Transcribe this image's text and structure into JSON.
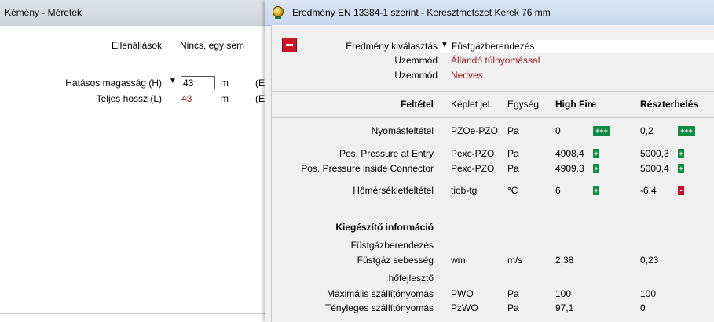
{
  "back_window": {
    "title": "Kémény - Méretek",
    "resistances_label": "Ellenállások",
    "resistances_value": "Nincs, egy sem",
    "height_label": "Hatásos magasság (H)",
    "height_value": "43",
    "height_unit": "m",
    "height_trailing": "(E",
    "length_label": "Teljes hossz (L)",
    "length_value": "43",
    "length_unit": "m",
    "length_trailing": "(E"
  },
  "front_window": {
    "title": "Eredmény EN 13384-1 szerint - Keresztmetszet Kerek 76 mm",
    "result_selection_label": "Eredmény kiválasztás",
    "result_selection_value": "Füstgázberendezés",
    "mode1_label": "Üzemmód",
    "mode1_value": "Állandó túlnyomással",
    "mode2_label": "Üzemmód",
    "mode2_value": "Nedves",
    "headers": {
      "condition": "Feltétel",
      "symbol": "Képlet jel.",
      "unit": "Egység",
      "high": "High Fire",
      "partial": "Részterhelés"
    },
    "rows": [
      {
        "label": "Nyomásfeltétel",
        "symbol": "PZOe-PZO",
        "unit": "Pa",
        "high": "0",
        "high_badge": "+++",
        "partial": "0,2",
        "partial_badge": "+++"
      },
      {
        "label": "Pos. Pressure at Entry",
        "symbol": "Pexc-PZO",
        "unit": "Pa",
        "high": "4908,4",
        "high_badge": "+",
        "partial": "5000,3",
        "partial_badge": "+"
      },
      {
        "label": "Pos. Pressure inside Connector",
        "symbol": "Pexc-PZO",
        "unit": "Pa",
        "high": "4909,3",
        "high_badge": "+",
        "partial": "5000,4",
        "partial_badge": "+"
      },
      {
        "label": "Hőmérsékletfeltétel",
        "symbol": "tiob-tg",
        "unit": "°C",
        "high": "6",
        "high_badge": "+",
        "partial": "-6,4",
        "partial_badge": "-"
      }
    ],
    "supplementary_title": "Kiegészítő információ",
    "section1": "Füstgázberendezés",
    "flue_speed_label": "Füstgáz sebesség",
    "flue_speed_symbol": "wm",
    "flue_speed_unit": "m/s",
    "flue_speed_high": "2,38",
    "flue_speed_partial": "0,23",
    "section2": "hőfejlesztő",
    "max_pressure_label": "Maximális szállítónyomás",
    "max_pressure_symbol": "PWO",
    "max_pressure_unit": "Pa",
    "max_pressure_high": "100",
    "max_pressure_partial": "100",
    "actual_pressure_label": "Tényleges szállítónyomás",
    "actual_pressure_symbol": "PzWO",
    "actual_pressure_unit": "Pa",
    "actual_pressure_high": "97,1",
    "actual_pressure_partial": "0"
  },
  "colors": {
    "ok_badge": "#0f8a43",
    "fail_badge": "#c4122e",
    "mode_text": "#9b1b1b"
  }
}
